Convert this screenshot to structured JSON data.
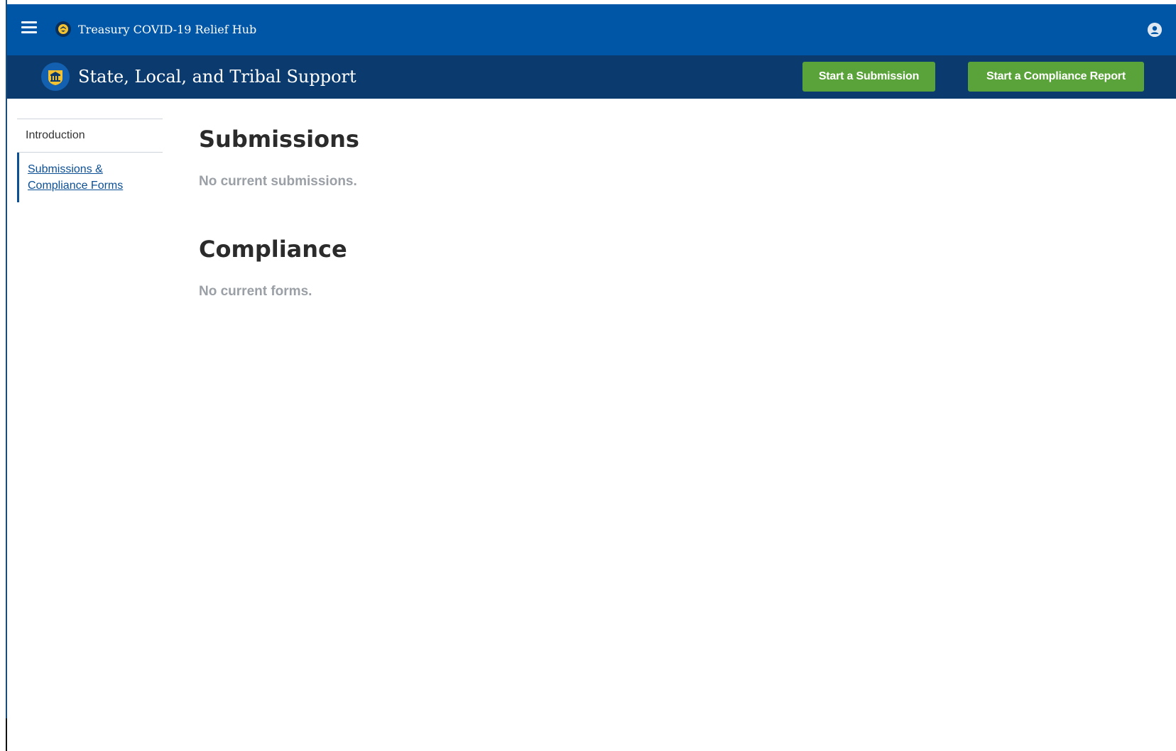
{
  "topbar": {
    "app_title": "Treasury COVID-19 Relief Hub",
    "menu_icon": "hamburger-menu-icon",
    "logo_icon": "treasury-seal-icon",
    "user_icon": "user-avatar-icon",
    "background": "#0056a6"
  },
  "subheader": {
    "title": "State, Local, and Tribal Support",
    "logo_icon": "treasury-building-icon",
    "background": "#0b3b6e",
    "buttons": {
      "start_submission": "Start a Submission",
      "start_compliance": "Start a Compliance Report"
    },
    "button_color": "#5aa33a"
  },
  "sidebar": {
    "items": [
      {
        "label": "Introduction",
        "active": false
      },
      {
        "label": "Submissions & Compliance Forms",
        "active": true
      }
    ]
  },
  "main": {
    "submissions": {
      "title": "Submissions",
      "empty_text": "No current submissions."
    },
    "compliance": {
      "title": "Compliance",
      "empty_text": "No current forms."
    }
  }
}
